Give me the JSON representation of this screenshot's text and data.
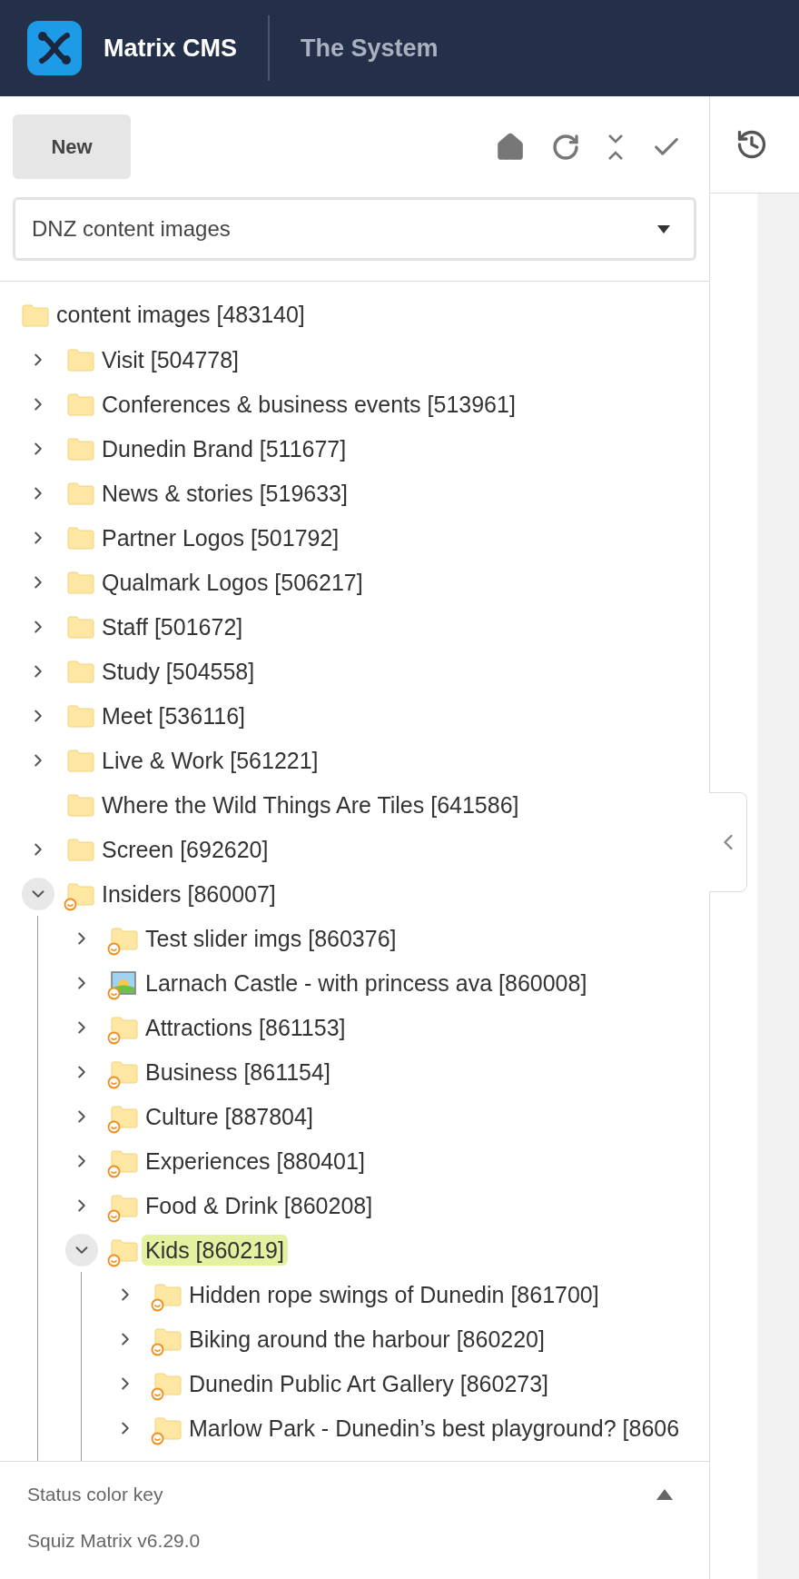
{
  "header": {
    "app_name": "Matrix CMS",
    "context": "The System"
  },
  "toolbar": {
    "new_button": "New"
  },
  "site_select": {
    "value": "DNZ content images"
  },
  "tree": {
    "label": "content images [483140]",
    "kind": "folder",
    "children": [
      {
        "label": "Visit [504778]",
        "kind": "folder",
        "expandable": true,
        "expanded": false,
        "selected": false,
        "status_badge": false
      },
      {
        "label": "Conferences & business events [513961]",
        "kind": "folder",
        "expandable": true,
        "expanded": false,
        "selected": false,
        "status_badge": false
      },
      {
        "label": "Dunedin Brand [511677]",
        "kind": "folder",
        "expandable": true,
        "expanded": false,
        "selected": false,
        "status_badge": false
      },
      {
        "label": "News & stories [519633]",
        "kind": "folder",
        "expandable": true,
        "expanded": false,
        "selected": false,
        "status_badge": false
      },
      {
        "label": "Partner Logos [501792]",
        "kind": "folder",
        "expandable": true,
        "expanded": false,
        "selected": false,
        "status_badge": false
      },
      {
        "label": "Qualmark Logos [506217]",
        "kind": "folder",
        "expandable": true,
        "expanded": false,
        "selected": false,
        "status_badge": false
      },
      {
        "label": "Staff [501672]",
        "kind": "folder",
        "expandable": true,
        "expanded": false,
        "selected": false,
        "status_badge": false
      },
      {
        "label": "Study [504558]",
        "kind": "folder",
        "expandable": true,
        "expanded": false,
        "selected": false,
        "status_badge": false
      },
      {
        "label": "Meet [536116]",
        "kind": "folder",
        "expandable": true,
        "expanded": false,
        "selected": false,
        "status_badge": false
      },
      {
        "label": "Live & Work [561221]",
        "kind": "folder",
        "expandable": true,
        "expanded": false,
        "selected": false,
        "status_badge": false
      },
      {
        "label": "Where the Wild Things Are Tiles [641586]",
        "kind": "folder",
        "expandable": false,
        "selected": false,
        "status_badge": false
      },
      {
        "label": "Screen [692620]",
        "kind": "folder",
        "expandable": true,
        "expanded": false,
        "selected": false,
        "status_badge": false
      },
      {
        "label": "Insiders [860007]",
        "kind": "folder",
        "expandable": true,
        "expanded": true,
        "selected": false,
        "status_badge": true,
        "children": [
          {
            "label": "Test slider imgs [860376]",
            "kind": "folder",
            "expandable": true,
            "expanded": false,
            "selected": false,
            "status_badge": true
          },
          {
            "label": "Larnach Castle - with princess ava [860008]",
            "kind": "image",
            "expandable": true,
            "expanded": false,
            "selected": false,
            "status_badge": true
          },
          {
            "label": "Attractions [861153]",
            "kind": "folder",
            "expandable": true,
            "expanded": false,
            "selected": false,
            "status_badge": true
          },
          {
            "label": "Business [861154]",
            "kind": "folder",
            "expandable": true,
            "expanded": false,
            "selected": false,
            "status_badge": true
          },
          {
            "label": "Culture [887804]",
            "kind": "folder",
            "expandable": true,
            "expanded": false,
            "selected": false,
            "status_badge": true
          },
          {
            "label": "Experiences [880401]",
            "kind": "folder",
            "expandable": true,
            "expanded": false,
            "selected": false,
            "status_badge": true
          },
          {
            "label": "Food & Drink [860208]",
            "kind": "folder",
            "expandable": true,
            "expanded": false,
            "selected": false,
            "status_badge": true
          },
          {
            "label": "Kids [860219]",
            "kind": "folder",
            "expandable": true,
            "expanded": true,
            "selected": true,
            "status_badge": true,
            "children": [
              {
                "label": "Hidden rope swings of Dunedin [861700]",
                "kind": "folder",
                "expandable": true,
                "expanded": false,
                "selected": false,
                "status_badge": true
              },
              {
                "label": "Biking around the harbour [860220]",
                "kind": "folder",
                "expandable": true,
                "expanded": false,
                "selected": false,
                "status_badge": true
              },
              {
                "label": "Dunedin Public Art Gallery [860273]",
                "kind": "folder",
                "expandable": true,
                "expanded": false,
                "selected": false,
                "status_badge": true
              },
              {
                "label": "Marlow Park - Dunedin’s best playground? [8606",
                "kind": "folder",
                "expandable": true,
                "expanded": false,
                "selected": false,
                "status_badge": true
              }
            ]
          }
        ]
      }
    ]
  },
  "status_key": {
    "label": "Status color key",
    "expanded": false
  },
  "footer": {
    "version": "Squiz Matrix v6.29.0"
  }
}
